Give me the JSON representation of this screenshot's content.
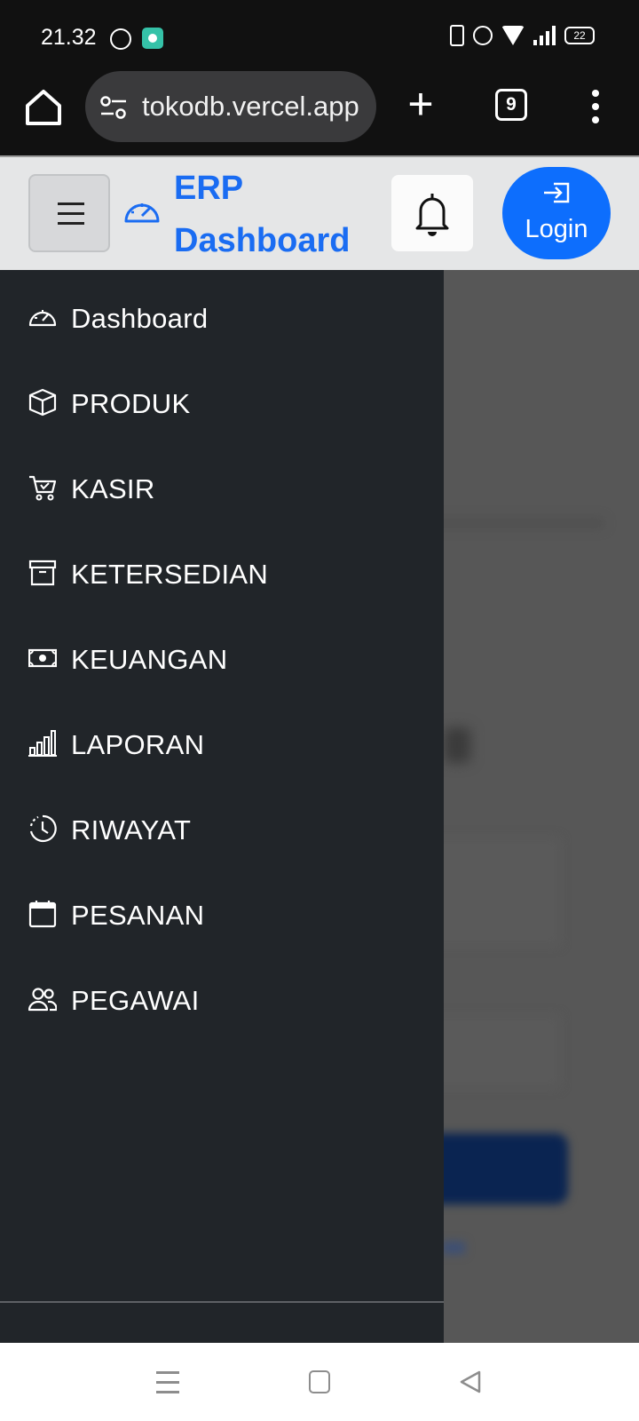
{
  "status_bar": {
    "time": "21.32",
    "battery": "22"
  },
  "browser": {
    "url": "tokodb.vercel.app",
    "tab_count": "9"
  },
  "navbar": {
    "brand": "ERP Dashboard",
    "brand_color": "#1a6cf2",
    "login_label": "Login",
    "login_color": "#0d6efd"
  },
  "sidebar": {
    "background": "#212529",
    "items": [
      {
        "label": "Dashboard",
        "icon": "speedometer-icon"
      },
      {
        "label": "PRODUK",
        "icon": "box-icon"
      },
      {
        "label": "KASIR",
        "icon": "cart-icon"
      },
      {
        "label": "KETERSEDIAN",
        "icon": "archive-icon"
      },
      {
        "label": "KEUANGAN",
        "icon": "cash-icon"
      },
      {
        "label": "LAPORAN",
        "icon": "bar-chart-icon"
      },
      {
        "label": "RIWAYAT",
        "icon": "clock-history-icon"
      },
      {
        "label": "PESANAN",
        "icon": "calendar-icon"
      },
      {
        "label": "PEGAWAI",
        "icon": "people-icon"
      }
    ]
  }
}
